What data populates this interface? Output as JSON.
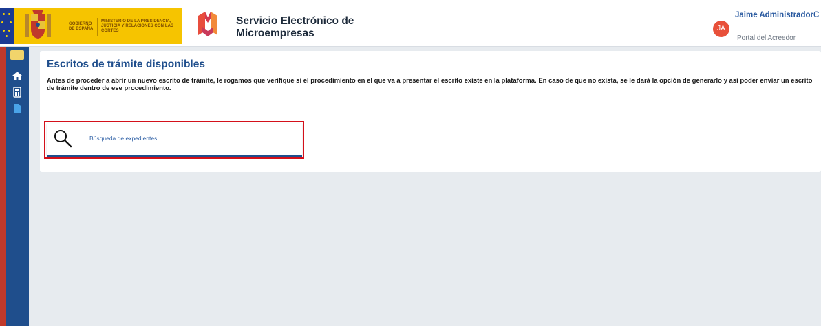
{
  "header": {
    "gov_line1": "Gobierno de España",
    "gov_line2": "Ministerio de la Presidencia, Justicia y Relaciones con las Cortes",
    "brand_title": "Servicio Electrónico de Microempresas",
    "user_initials": "JA",
    "user_name": "Jaime AdministradorC",
    "user_role": "Portal del Acreedor"
  },
  "sidebar": {
    "items": [
      {
        "icon": "home-icon"
      },
      {
        "icon": "calculator-icon"
      },
      {
        "icon": "document-icon"
      }
    ]
  },
  "main": {
    "title": "Escritos de trámite disponibles",
    "description": "Antes de proceder a abrir un nuevo escrito de trámite, le rogamos que verifique si el procedimiento en el que va a presentar el escrito existe en la plataforma. En caso de que no exista, se le dará la opción de generarlo y así poder enviar un escrito de trámite dentro de ese procedimiento.",
    "card_label": "Búsqueda de expedientes",
    "card_icon": "search-icon"
  },
  "colors": {
    "primary": "#1f4e8c",
    "highlight": "#d4101a",
    "gov_yellow": "#f6c400",
    "avatar": "#e8503a"
  }
}
